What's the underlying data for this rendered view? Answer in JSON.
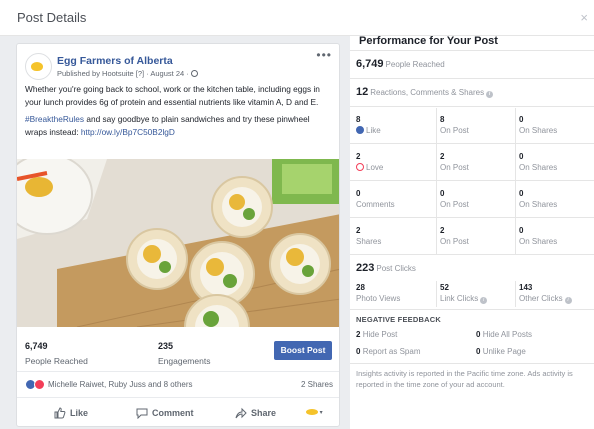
{
  "dialog": {
    "title": "Post Details",
    "close": "×"
  },
  "post": {
    "page_name": "Egg Farmers of Alberta",
    "published_by": "Published by Hootsuite [?] · August 24 ·",
    "more": "•••",
    "text_1": "Whether you're going back to school, work or the kitchen table, including eggs in your lunch provides 6g of protein and essential nutrients like vitamin A, D and E.",
    "hashtag": "#BreaktheRules",
    "text_2": " and say goodbye to plain sandwiches and try these pinwheel wraps instead: ",
    "link": "http://ow.ly/Bp7C50B2lgD",
    "photo_alt": "egg-pinwheel-wraps-photo"
  },
  "post_stats": {
    "reached_value": "6,749",
    "reached_label": "People Reached",
    "engagements_value": "235",
    "engagements_label": "Engagements",
    "boost_label": "Boost Post"
  },
  "reactions": {
    "names": "Michelle Raiwet, Ruby Juss and 8 others",
    "shares": "2 Shares"
  },
  "actions": {
    "like": "Like",
    "comment": "Comment",
    "share": "Share",
    "selector": "▾"
  },
  "performance": {
    "title": "Performance for Your Post",
    "people_reached_value": "6,749",
    "people_reached_label": "People Reached",
    "reactions_value": "12",
    "reactions_label": "Reactions, Comments & Shares",
    "rows": [
      {
        "total": "8",
        "total_label": "Like",
        "on_post": "8",
        "on_post_label": "On Post",
        "on_shares": "0",
        "on_shares_label": "On Shares"
      },
      {
        "total": "2",
        "total_label": "Love",
        "on_post": "2",
        "on_post_label": "On Post",
        "on_shares": "0",
        "on_shares_label": "On Shares"
      },
      {
        "total": "0",
        "total_label": "Comments",
        "on_post": "0",
        "on_post_label": "On Post",
        "on_shares": "0",
        "on_shares_label": "On Shares"
      },
      {
        "total": "2",
        "total_label": "Shares",
        "on_post": "2",
        "on_post_label": "On Post",
        "on_shares": "0",
        "on_shares_label": "On Shares"
      }
    ],
    "post_clicks_value": "223",
    "post_clicks_label": "Post Clicks",
    "clicks": {
      "photo_views_value": "28",
      "photo_views_label": "Photo Views",
      "link_clicks_value": "52",
      "link_clicks_label": "Link Clicks",
      "other_clicks_value": "143",
      "other_clicks_label": "Other Clicks"
    },
    "negative": {
      "title": "NEGATIVE FEEDBACK",
      "hide_post_value": "2",
      "hide_post_label": "Hide Post",
      "hide_all_value": "0",
      "hide_all_label": "Hide All Posts",
      "spam_value": "0",
      "spam_label": "Report as Spam",
      "unlike_value": "0",
      "unlike_label": "Unlike Page"
    },
    "footnote": "Insights activity is reported in the Pacific time zone. Ads activity is reported in the time zone of your ad account."
  },
  "colors": {
    "facebook_blue": "#4267b2",
    "link_blue": "#365899",
    "love_red": "#f33e58",
    "muted_gray": "#90949c"
  }
}
